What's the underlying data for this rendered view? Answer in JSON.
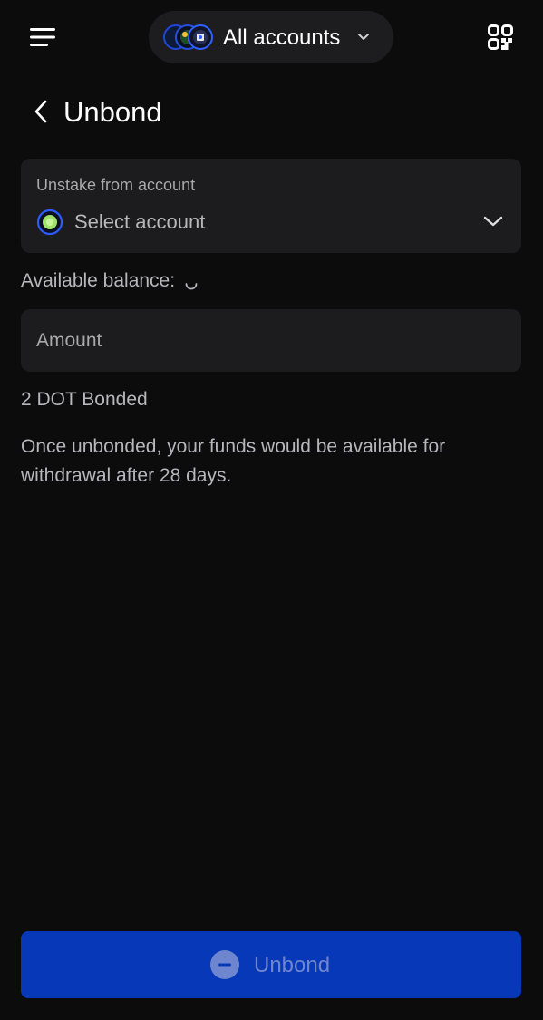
{
  "header": {
    "account_selector_label": "All accounts",
    "icons": {
      "menu": "hamburger-menu-icon",
      "avatars": "stacked-account-avatars-icon",
      "dropdown": "chevron-down-icon",
      "qr": "qr-code-icon"
    }
  },
  "page": {
    "title": "Unbond",
    "back_icon": "chevron-left-icon"
  },
  "account_field": {
    "caption": "Unstake from account",
    "placeholder": "Select account",
    "icon": "account-identicon-icon",
    "dropdown_icon": "chevron-down-icon"
  },
  "balance": {
    "label": "Available balance:",
    "loading_icon": "loading-spinner-icon"
  },
  "amount": {
    "placeholder": "Amount",
    "value": ""
  },
  "bonded_text": "2 DOT Bonded",
  "info_text": "Once unbonded, your funds would be available for withdrawal after 28 days.",
  "submit": {
    "label": "Unbond",
    "icon": "minus-circle-icon",
    "state": "disabled"
  },
  "colors": {
    "background": "#0c0c0c",
    "card": "#1c1c1e",
    "text_primary": "#ffffff",
    "text_secondary": "#b6b6bb",
    "button_bg": "#0638b7",
    "button_text_disabled": "#6e86d0"
  }
}
